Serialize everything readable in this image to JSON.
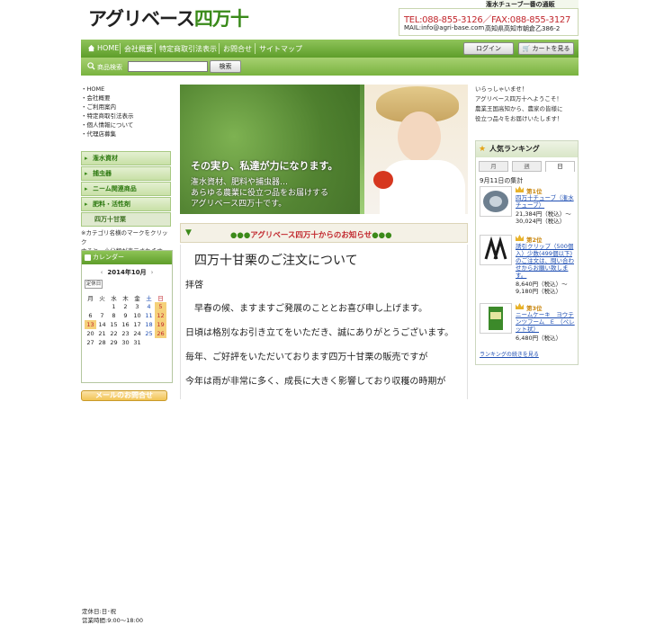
{
  "header": {
    "logo_main": "アグリベース",
    "logo_accent": "四万十",
    "ribbon": "潅水チューブ一番の通販",
    "tel": "TEL:088-855-3126／FAX:088-855-3127",
    "mail": "MAIL:info@agri-base.com",
    "address": "高知県高知市朝倉乙386-2"
  },
  "nav": {
    "items": [
      "HOME",
      "会社概要",
      "特定商取引法表示",
      "お問合せ",
      "サイトマップ"
    ],
    "login": "ログイン",
    "cart": "カートを見る"
  },
  "search": {
    "label": "商品検索",
    "value": "",
    "button": "検索"
  },
  "sidebar": {
    "links": [
      "HOME",
      "会社概要",
      "ご利用案内",
      "特定商取引法表示",
      "個人情報について",
      "代理店募集"
    ],
    "categories": [
      "潅水資材",
      "捕虫器",
      "ニーム関連商品",
      "肥料・活性剤",
      "四万十甘栗"
    ],
    "note_line1": "※カテゴリ名横のマークをクリック",
    "note_line2": "すると、小分類が表示されます。"
  },
  "calendar": {
    "title": "カレンダー",
    "month": "2014年10月",
    "prev": "‹",
    "next": "›",
    "closed_tag": "定休日",
    "weekdays": [
      "月",
      "火",
      "水",
      "木",
      "金",
      "土",
      "日"
    ],
    "weeks": [
      [
        "",
        "",
        "1",
        "2",
        "3",
        "4",
        "5"
      ],
      [
        "6",
        "7",
        "8",
        "9",
        "10",
        "11",
        "12"
      ],
      [
        "13",
        "14",
        "15",
        "16",
        "17",
        "18",
        "19"
      ],
      [
        "20",
        "21",
        "22",
        "23",
        "24",
        "25",
        "26"
      ],
      [
        "27",
        "28",
        "29",
        "30",
        "31",
        "",
        ""
      ]
    ],
    "info_line1": "定休日:日･祝",
    "info_line2": "営業時間:9:00～18:00"
  },
  "mail_button": "メールのお問合せ",
  "hero": {
    "line1": "その実り、私達が力になります。",
    "line2": "潅水資材、肥料や捕虫器…",
    "line3": "あらゆる農業に役立つ品をお届けする",
    "line4": "アグリベース四万十です。"
  },
  "notice": {
    "dots_left": "●●●",
    "title": "アグリベース四万十からのお知らせ",
    "dots_right": "●●●"
  },
  "article": {
    "heading": "四万十甘栗のご注文について",
    "p1": "拝啓",
    "p2": "　早春の候、ますますご発展のこととお喜び申し上げます。",
    "p3": "日頃は格別なお引き立てをいただき、誠にありがとうございます。",
    "p4": "毎年、ご好評をいただいております四万十甘栗の販売ですが",
    "p5": "今年は雨が非常に多く、成長に大きく影響しており収穫の時期が"
  },
  "greeting": {
    "l1": "いらっしゃいませ！",
    "l2": "アグリベース四万十へようこそ！",
    "l3": "農業王国高知から、農家の皆様に",
    "l4": "役立つ品々をお届けいたします！"
  },
  "ranking": {
    "title": "人気ランキング",
    "tabs": [
      "月",
      "週",
      "日"
    ],
    "date": "9月11日の集計",
    "items": [
      {
        "rank": "第1位",
        "name": "四万十チューブ（潅水チューブ）",
        "price": "21,384円（税込）～30,024円（税込）"
      },
      {
        "rank": "第2位",
        "name": "誘引クリップ（500個入）少数(499個以下)のご注文は、問い合わせからお願い致します。",
        "price": "8,640円（税込）～9,180円（税込）"
      },
      {
        "rank": "第3位",
        "name": "ニームケーキ　ヨウテンツフーム　E　（ペレット状）",
        "price": "6,480円（税込）"
      }
    ],
    "more": "ランキングの続きを見る"
  },
  "colors": {
    "accent_green": "#5e9d2a",
    "accent_red": "#c1272d",
    "link_blue": "#1f4fb3"
  }
}
